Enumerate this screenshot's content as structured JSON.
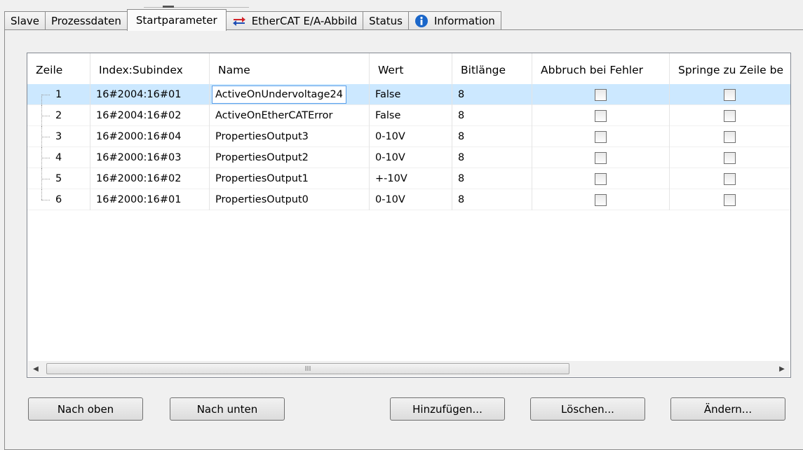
{
  "tabs": [
    {
      "label": "Slave"
    },
    {
      "label": "Prozessdaten"
    },
    {
      "label": "Startparameter",
      "active": true
    },
    {
      "label": "EtherCAT E/A-Abbild",
      "icon": "swap-arrows-icon"
    },
    {
      "label": "Status"
    },
    {
      "label": "Information",
      "icon": "info-icon"
    }
  ],
  "table": {
    "columns": [
      "Zeile",
      "Index:Subindex",
      "Name",
      "Wert",
      "Bitlänge",
      "Abbruch bei Fehler",
      "Springe zu Zeile be"
    ],
    "rows": [
      {
        "zeile": "1",
        "index": "16#2004:16#01",
        "name": "ActiveOnUndervoltage24",
        "wert": "False",
        "bits": "8",
        "abort": false,
        "jump": false
      },
      {
        "zeile": "2",
        "index": "16#2004:16#02",
        "name": "ActiveOnEtherCATError",
        "wert": "False",
        "bits": "8",
        "abort": false,
        "jump": false
      },
      {
        "zeile": "3",
        "index": "16#2000:16#04",
        "name": "PropertiesOutput3",
        "wert": "0-10V",
        "bits": "8",
        "abort": false,
        "jump": false
      },
      {
        "zeile": "4",
        "index": "16#2000:16#03",
        "name": "PropertiesOutput2",
        "wert": "0-10V",
        "bits": "8",
        "abort": false,
        "jump": false
      },
      {
        "zeile": "5",
        "index": "16#2000:16#02",
        "name": "PropertiesOutput1",
        "wert": "+-10V",
        "bits": "8",
        "abort": false,
        "jump": false
      },
      {
        "zeile": "6",
        "index": "16#2000:16#01",
        "name": "PropertiesOutput0",
        "wert": "0-10V",
        "bits": "8",
        "abort": false,
        "jump": false
      }
    ],
    "selected_row": 0,
    "scroll_grip": "III"
  },
  "buttons": {
    "up": "Nach oben",
    "down": "Nach unten",
    "add": "Hinzufügen...",
    "delete": "Löschen...",
    "edit": "Ändern..."
  },
  "colors": {
    "selection": "#cce8ff",
    "swap_icon_red": "#d1232a",
    "swap_icon_blue": "#1f4fb5",
    "info_icon": "#1a66c9"
  }
}
